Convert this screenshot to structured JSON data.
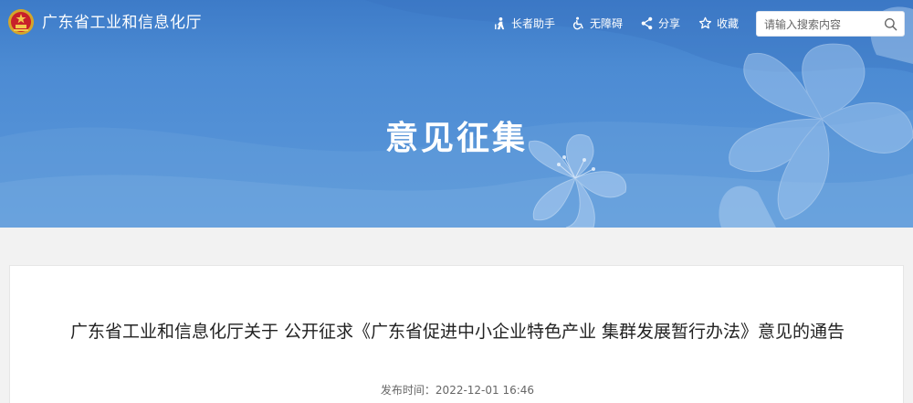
{
  "header": {
    "site_title": "广东省工业和信息化厅",
    "logo_icon": "national-emblem-icon",
    "tools": {
      "elder_mode": "长者助手",
      "accessibility": "无障碍",
      "share": "分享",
      "favorite": "收藏"
    },
    "search": {
      "placeholder": "请输入搜索内容",
      "icon": "search-icon"
    }
  },
  "banner": {
    "title": "意见征集",
    "decoration": "lily-flower-illustration"
  },
  "article": {
    "title": "广东省工业和信息化厅关于 公开征求《广东省促进中小企业特色产业 集群发展暂行办法》意见的通告",
    "published_label": "发布时间：2022-12-01 16:46"
  },
  "colors": {
    "banner_blue": "#4c8bd3",
    "page_background": "#f2f2f2",
    "card_background": "#ffffff"
  }
}
